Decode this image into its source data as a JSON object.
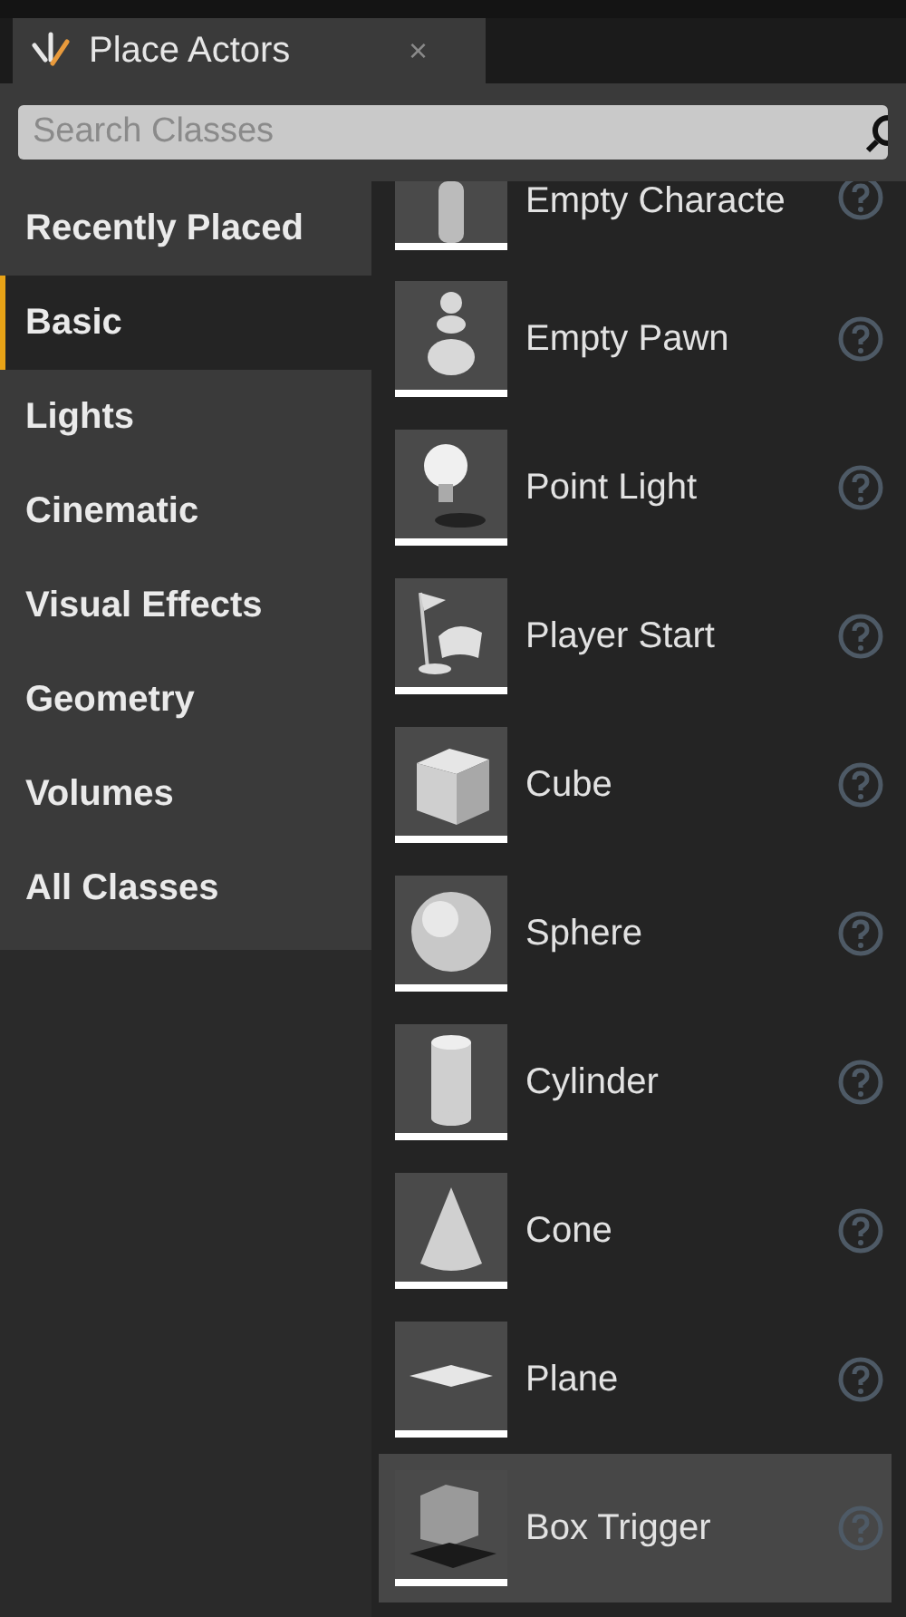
{
  "tab": {
    "title": "Place Actors",
    "close": "×"
  },
  "search": {
    "placeholder": "Search Classes"
  },
  "categories": [
    {
      "label": "Recently Placed",
      "selected": false
    },
    {
      "label": "Basic",
      "selected": true
    },
    {
      "label": "Lights",
      "selected": false
    },
    {
      "label": "Cinematic",
      "selected": false
    },
    {
      "label": "Visual Effects",
      "selected": false
    },
    {
      "label": "Geometry",
      "selected": false
    },
    {
      "label": "Volumes",
      "selected": false
    },
    {
      "label": "All Classes",
      "selected": false
    }
  ],
  "actors": [
    {
      "name": "Empty Characte",
      "kind": "character",
      "highlighted": false
    },
    {
      "name": "Empty Pawn",
      "kind": "pawn",
      "highlighted": false
    },
    {
      "name": "Point Light",
      "kind": "light",
      "highlighted": false
    },
    {
      "name": "Player Start",
      "kind": "start",
      "highlighted": false
    },
    {
      "name": "Cube",
      "kind": "cube",
      "highlighted": false
    },
    {
      "name": "Sphere",
      "kind": "sphere",
      "highlighted": false
    },
    {
      "name": "Cylinder",
      "kind": "cylinder",
      "highlighted": false
    },
    {
      "name": "Cone",
      "kind": "cone",
      "highlighted": false
    },
    {
      "name": "Plane",
      "kind": "plane",
      "highlighted": false
    },
    {
      "name": "Box Trigger",
      "kind": "trigger",
      "highlighted": true
    }
  ]
}
